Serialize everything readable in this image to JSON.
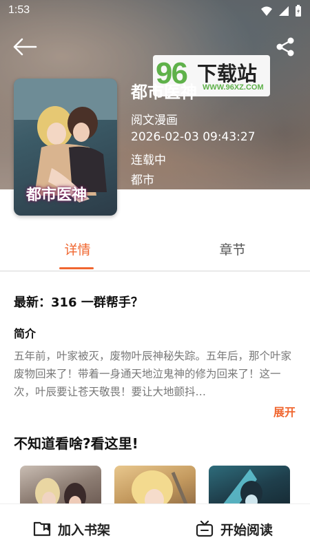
{
  "status": {
    "time": "1:53"
  },
  "book": {
    "title": "都市医神",
    "cover_title": "都市医神",
    "author": "阅文漫画",
    "updated": "2026-02-03 09:43:27",
    "state": "连载中",
    "category": "都市"
  },
  "watermark": {
    "number": "96",
    "text": "下载站",
    "url": "WWW.96XZ.COM"
  },
  "tabs": [
    {
      "label": "详情",
      "active": true
    },
    {
      "label": "章节",
      "active": false
    }
  ],
  "details": {
    "latest": "最新：316 一群帮手？",
    "intro_label": "简介",
    "intro_text": "五年前，叶家被灭，废物叶辰神秘失踪。五年后，那个叶家废物回来了！带着一身通天地泣鬼神的修为回来了！这一次，叶辰要让苍天敬畏！要让大地颤抖…",
    "expand_label": "展开"
  },
  "recommend": {
    "title": "不知道看啥?看这里!"
  },
  "bottom": {
    "add_shelf": "加入书架",
    "start_read": "开始阅读"
  },
  "colors": {
    "accent": "#f0662f",
    "watermark_green": "#5fb14a"
  }
}
